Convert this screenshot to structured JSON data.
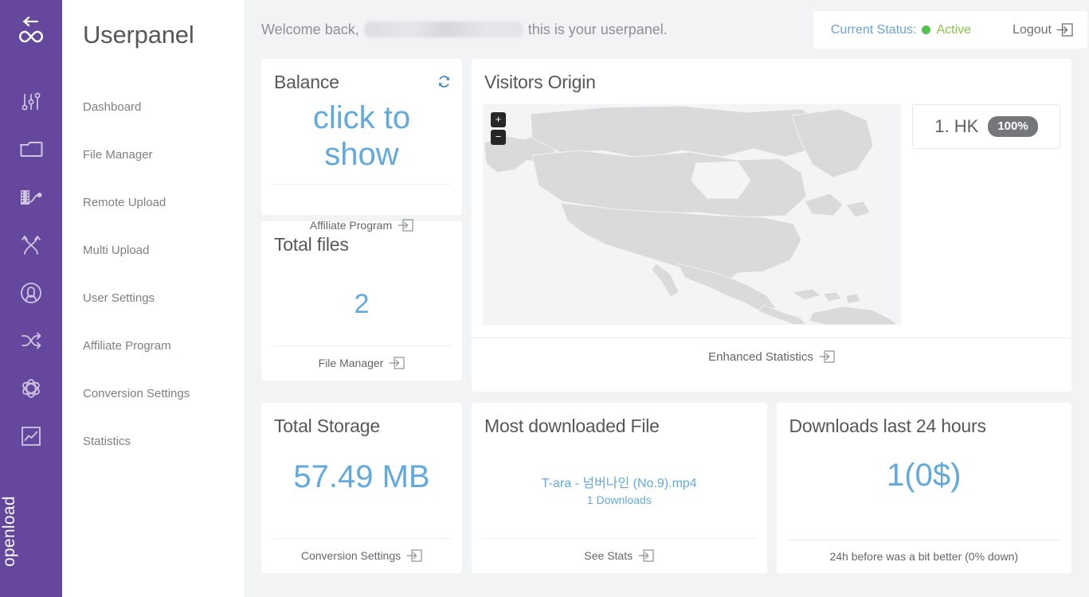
{
  "brand": {
    "name": "openload",
    "logo_icon": "infinity-icon",
    "back_icon": "back-arrow-icon"
  },
  "sidebar": {
    "title": "Userpanel",
    "items": [
      {
        "label": "Dashboard",
        "icon": "sliders-icon"
      },
      {
        "label": "File Manager",
        "icon": "folder-icon"
      },
      {
        "label": "Remote Upload",
        "icon": "film-link-icon"
      },
      {
        "label": "Multi Upload",
        "icon": "arrows-cross-up-icon"
      },
      {
        "label": "User Settings",
        "icon": "user-circle-icon"
      },
      {
        "label": "Affiliate Program",
        "icon": "shuffle-icon"
      },
      {
        "label": "Conversion Settings",
        "icon": "atom-icon"
      },
      {
        "label": "Statistics",
        "icon": "chart-box-icon"
      }
    ]
  },
  "header": {
    "welcome_prefix": "Welcome back,",
    "welcome_suffix": "this is your userpanel.",
    "username_redacted": "",
    "status_label": "Current Status:",
    "status_value": "Active",
    "status_color": "#8bc34a",
    "status_dot_color": "#4ec14e",
    "logout_label": "Logout",
    "logout_icon": "logout-arrow-icon"
  },
  "cards": {
    "balance": {
      "title": "Balance",
      "value_line1": "click to",
      "value_line2": "show",
      "refresh_icon": "refresh-icon",
      "footer_label": "Affiliate Program",
      "footer_icon": "arrow-right-box-icon"
    },
    "total_files": {
      "title": "Total files",
      "value": "2",
      "footer_label": "File Manager",
      "footer_icon": "arrow-right-box-icon"
    },
    "visitors_origin": {
      "title": "Visitors Origin",
      "zoom_in": "+",
      "zoom_out": "−",
      "legend": [
        {
          "rank": "1. HK",
          "percent": "100%"
        }
      ],
      "footer_label": "Enhanced Statistics",
      "footer_icon": "arrow-right-box-icon"
    },
    "total_storage": {
      "title": "Total Storage",
      "value": "57.49 MB",
      "footer_label": "Conversion Settings",
      "footer_icon": "arrow-right-box-icon"
    },
    "most_downloaded": {
      "title": "Most downloaded File",
      "file_name": "T-ara - 넘버나인 (No.9).mp4",
      "downloads": "1 Downloads",
      "footer_label": "See Stats",
      "footer_icon": "arrow-right-box-icon"
    },
    "downloads_24h": {
      "title": "Downloads last 24 hours",
      "value": "1(0$)",
      "footer_label": "24h before was a bit better (0% down)"
    }
  },
  "colors": {
    "rail_purple": "#65479d",
    "accent_blue": "#62aadd",
    "page_bg": "#f2f3f5",
    "map_land": "#d9dadc",
    "map_water": "#f2f4f5"
  }
}
